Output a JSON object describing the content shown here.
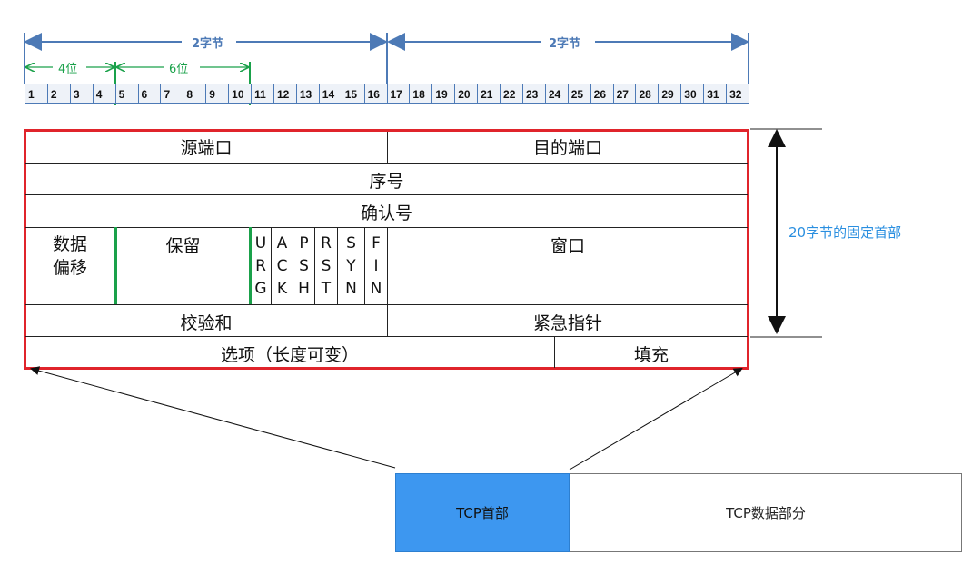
{
  "ruler": {
    "two_bytes_left": "2字节",
    "two_bytes_right": "2字节",
    "four_bits": "4位",
    "six_bits": "6位",
    "bits": [
      "1",
      "2",
      "3",
      "4",
      "5",
      "6",
      "7",
      "8",
      "9",
      "10",
      "11",
      "12",
      "13",
      "14",
      "15",
      "16",
      "17",
      "18",
      "19",
      "20",
      "21",
      "22",
      "23",
      "24",
      "25",
      "26",
      "27",
      "28",
      "29",
      "30",
      "31",
      "32"
    ]
  },
  "header": {
    "source_port": "源端口",
    "dest_port": "目的端口",
    "seq": "序号",
    "ack_no": "确认号",
    "data_offset": [
      "数据",
      "偏移"
    ],
    "reserved": "保留",
    "flags": [
      [
        "U",
        "R",
        "G"
      ],
      [
        "A",
        "C",
        "K"
      ],
      [
        "P",
        "S",
        "H"
      ],
      [
        "R",
        "S",
        "T"
      ],
      [
        "S",
        "Y",
        "N"
      ],
      [
        "F",
        "I",
        "N"
      ]
    ],
    "window": "窗口",
    "checksum": "校验和",
    "urgent_pointer": "紧急指针",
    "options": "选项（长度可变）",
    "padding": "填充"
  },
  "side_label": "20字节的固定首部",
  "segment": {
    "header": "TCP首部",
    "data": "TCP数据部分"
  },
  "colors": {
    "ruler_blue": "#4d7ab6",
    "green_marker": "#1aa14a",
    "red_border": "#e0242b",
    "side_label": "#2a8fe0",
    "tcp_header_fill": "#3d97f0"
  }
}
